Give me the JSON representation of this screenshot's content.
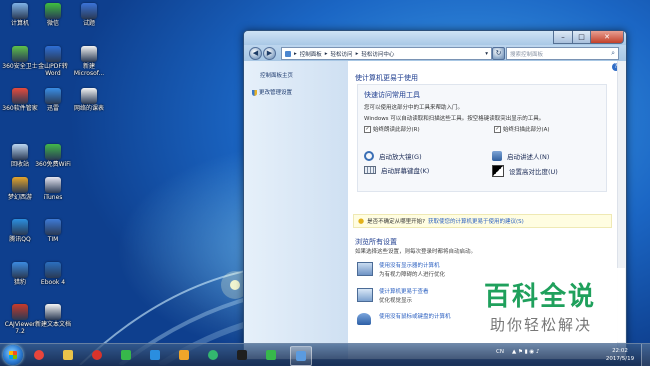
{
  "desktop": {
    "icons": [
      {
        "label": "计算机",
        "color": "#7fb3e8"
      },
      {
        "label": "微信",
        "color": "#3fbf3f"
      },
      {
        "label": "试题",
        "color": "#3b73d8"
      },
      {
        "label": "360安全卫士",
        "color": "#5ec24a"
      },
      {
        "label": "金山PDF转Word",
        "color": "#2f6fd6"
      },
      {
        "label": "新建Microsof...",
        "color": "#f2f2f2"
      },
      {
        "label": "360软件管家",
        "color": "#e84b3c"
      },
      {
        "label": "迅雷",
        "color": "#3a8ee6"
      },
      {
        "label": "网络的课表",
        "color": "#f4f4f4"
      },
      {
        "label": "回收站",
        "color": "#bcd7f2"
      },
      {
        "label": "360免费WiFi",
        "color": "#42b84a"
      },
      {
        "label": "梦幻西游",
        "color": "#e5a52b"
      },
      {
        "label": "iTunes",
        "color": "#e6e6f2"
      },
      {
        "label": "腾讯QQ",
        "color": "#2b8fe0"
      },
      {
        "label": "TIM",
        "color": "#3e7ad6"
      },
      {
        "label": "猎豹",
        "color": "#3c8be0"
      },
      {
        "label": "Ebook 4",
        "color": "#2b6fbf"
      },
      {
        "label": "CAJViewer 7.2",
        "color": "#c93a2a"
      },
      {
        "label": "新建文本文档",
        "color": "#f5f5f5"
      }
    ]
  },
  "window": {
    "breadcrumb": [
      "控制面板",
      "轻松访问",
      "轻松访问中心"
    ],
    "search_placeholder": "搜索控制面板",
    "buttons": {
      "minimize": "–",
      "maximize": "□",
      "close": "✕",
      "back": "◀",
      "forward": "▶",
      "refresh": "↻",
      "help": "?"
    },
    "left_pane": {
      "home": "控制面板主页",
      "change_admin": "更改管理设置"
    },
    "main": {
      "heading": "使计算机更易于使用",
      "quick_title": "快速访问常用工具",
      "quick_line1": "您可以使用这部分中的工具来帮助入门。",
      "quick_line2": "Windows 可以自动读取和扫描这些工具。按空格键读取突出显示的工具。",
      "check1": "始终朗读此部分(R)",
      "check2": "始终扫描此部分(A)",
      "tools": [
        {
          "label": "启动放大镜(G)",
          "icon": "magnifier-icon"
        },
        {
          "label": "启动讲述人(N)",
          "icon": "narrator-icon"
        },
        {
          "label": "启动屏幕键盘(K)",
          "icon": "keyboard-icon"
        },
        {
          "label": "设置高对比度(U)",
          "icon": "contrast-icon"
        }
      ],
      "tip_text": "是否不确定从哪里开始?",
      "tip_link": "获取使您的计算机更易于使用的建议(S)",
      "browse_title": "浏览所有设置",
      "browse_desc": "如果选择这些设置，则每次登录时都将自动启动。",
      "items": [
        {
          "title": "使用没有显示器的计算机",
          "desc": "为有视力障碍的人进行优化"
        },
        {
          "title": "使计算机更易于查看",
          "desc": "优化视觉显示"
        },
        {
          "title": "使用没有鼠标或键盘的计算机",
          "desc": ""
        }
      ]
    }
  },
  "watermark": {
    "big": "百科全说",
    "small": "助你轻松解决"
  },
  "taskbar": {
    "apps": [
      "chrome",
      "explorer",
      "netease-music",
      "iqiyi",
      "star",
      "ie",
      "wifi",
      "terminal",
      "iqiyi-2",
      "control-panel"
    ],
    "lang": "CN",
    "time": "22:02",
    "date": "2017/5/19"
  }
}
